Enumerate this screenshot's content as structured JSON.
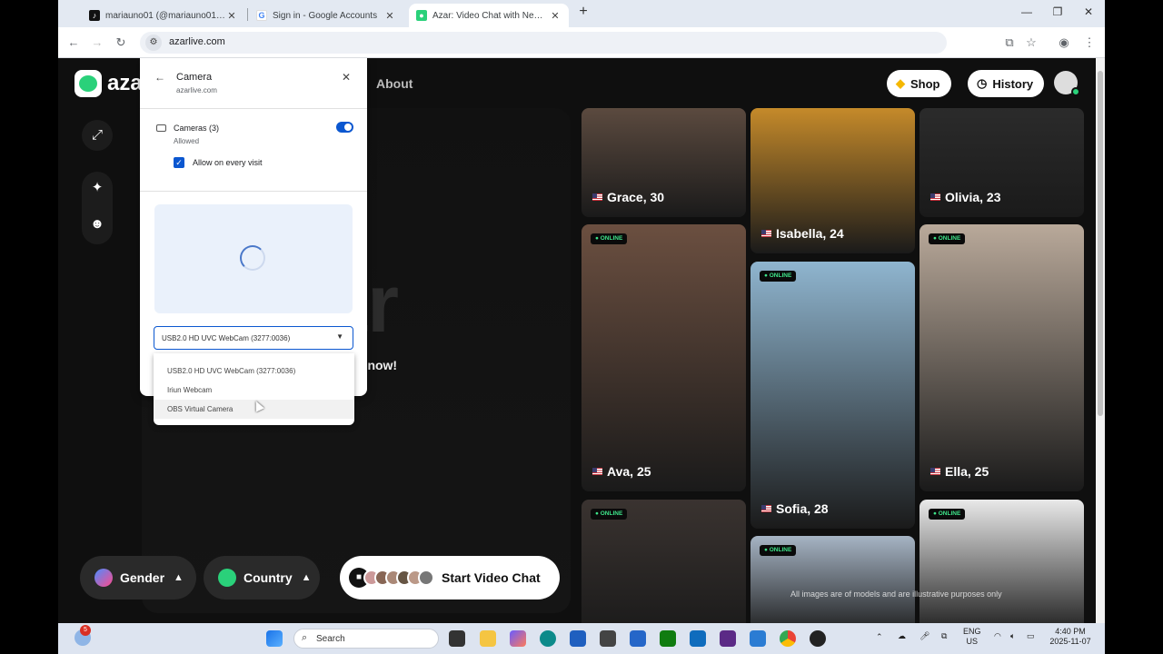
{
  "browser": {
    "tabs": [
      {
        "title": "mariauno01 (@mariauno01) | T",
        "icon": "tiktok-icon"
      },
      {
        "title": "Sign in - Google Accounts",
        "icon": "google-icon"
      },
      {
        "title": "Azar: Video Chat with New Peo",
        "icon": "azar-icon",
        "active": true
      }
    ],
    "new_tab": "+",
    "url": "azarlive.com"
  },
  "site": {
    "brand": "aza",
    "nav_about": "About",
    "shop_label": "Shop",
    "history_label": "History",
    "big_brand": "ar",
    "tagline": "g now!",
    "gender_label": "Gender",
    "country_label": "Country",
    "start_label": "Start Video Chat",
    "disclaimer": "All images are of models and are illustrative purposes only",
    "accent": "#2ad17a"
  },
  "cards": [
    {
      "name": "Grace, 30",
      "online": false,
      "color": "#5b4a3f"
    },
    {
      "name": "Isabella, 24",
      "online": false,
      "color": "#c58a2a"
    },
    {
      "name": "Olivia, 23",
      "online": false,
      "color": "#2b2b2b"
    },
    {
      "name": "Ava, 25",
      "online": true,
      "color": "#6b4f40"
    },
    {
      "name": "Sofia, 28",
      "online": true,
      "color": "#8fb5cf"
    },
    {
      "name": "Ella, 25",
      "online": true,
      "color": "#b9a99a"
    },
    {
      "name": "",
      "online": true,
      "color": "#3a3330"
    },
    {
      "name": "",
      "online": true,
      "color": "#a6b4c4"
    },
    {
      "name": "",
      "online": true,
      "color": "#e9e9e9"
    }
  ],
  "online_label": "● ONLINE",
  "permission": {
    "title": "Camera",
    "domain": "azarlive.com",
    "cameras_label": "Cameras (3)",
    "cameras_status": "Allowed",
    "allow_label": "Allow on every visit",
    "selected_camera": "USB2.0 HD UVC WebCam (3277:0036)",
    "options": [
      "USB2.0 HD UVC WebCam (3277:0036)",
      "Iriun Webcam",
      "OBS Virtual Camera"
    ]
  },
  "taskbar": {
    "search_placeholder": "Search",
    "badge": "5",
    "lang": "ENG",
    "region": "US",
    "time": "4:40 PM",
    "date": "2025-11-07"
  }
}
